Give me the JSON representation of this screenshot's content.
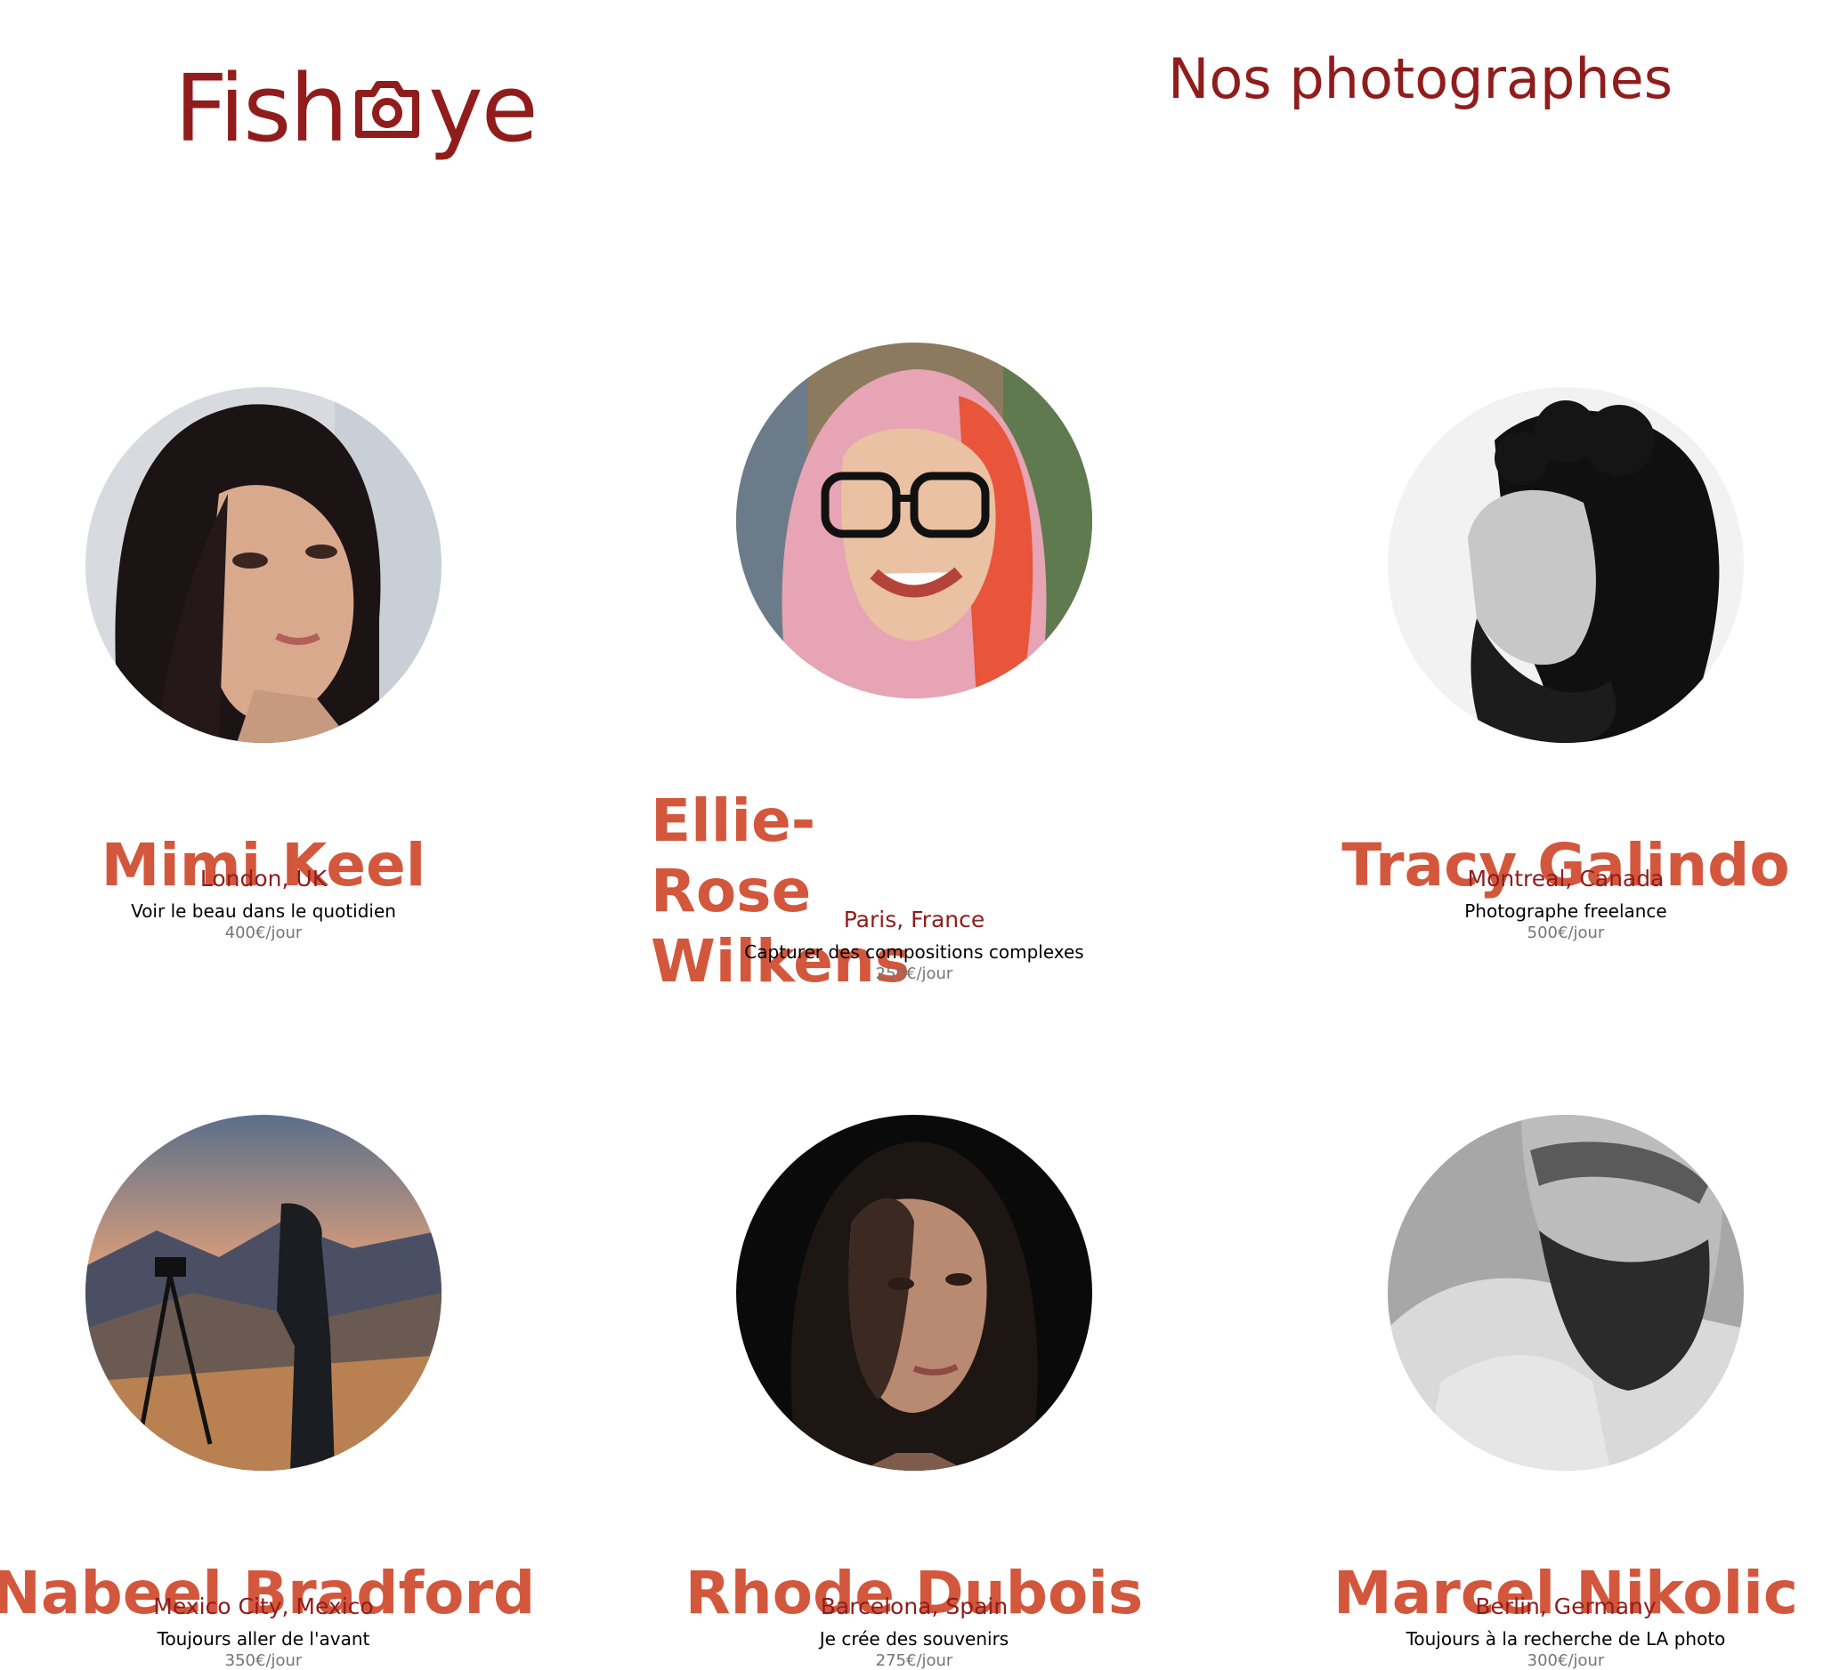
{
  "header": {
    "logo_text_left": "Fish",
    "logo_text_right": "ye",
    "logo_icon": "camera-icon",
    "title": "Nos photographes"
  },
  "colors": {
    "primary": "#901c1c",
    "secondary": "#d3573c",
    "tagline": "#000000",
    "price": "#757575"
  },
  "photographers": [
    {
      "name": "Mimi Keel",
      "location": "London, UK",
      "tagline": "Voir le beau dans le quotidien",
      "price": "400€/jour"
    },
    {
      "name": "Ellie-Rose Wilkens",
      "location": "Paris, France",
      "tagline": "Capturer des compositions complexes",
      "price": "250€/jour"
    },
    {
      "name": "Tracy Galindo",
      "location": "Montreal, Canada",
      "tagline": "Photographe freelance",
      "price": "500€/jour"
    },
    {
      "name": "Nabeel Bradford",
      "location": "Mexico City, Mexico",
      "tagline": "Toujours aller de l'avant",
      "price": "350€/jour"
    },
    {
      "name": "Rhode Dubois",
      "location": "Barcelona, Spain",
      "tagline": "Je crée des souvenirs",
      "price": "275€/jour"
    },
    {
      "name": "Marcel Nikolic",
      "location": "Berlin, Germany",
      "tagline": "Toujours à la recherche de LA photo",
      "price": "300€/jour"
    }
  ]
}
